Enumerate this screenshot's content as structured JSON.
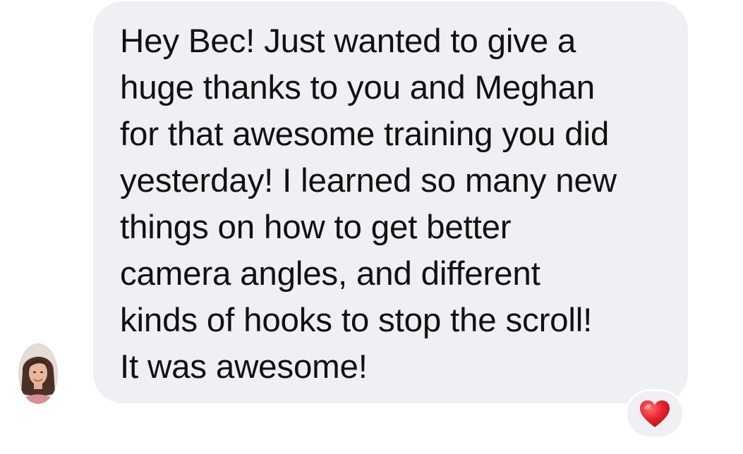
{
  "message": {
    "text": "Hey Bec! Just wanted to give a\nhuge thanks to you and Meghan\nfor that awesome training you did\nyesterday! I learned so many new\nthings on how to get better\ncamera angles, and different\nkinds of hooks to stop the scroll!\nIt was awesome!",
    "bubble_color": "#efeff4",
    "text_color": "#111111"
  },
  "sender": {
    "avatar_icon": "profile-photo"
  },
  "reaction": {
    "icon": "red-heart-icon",
    "color": "#e8232f"
  }
}
